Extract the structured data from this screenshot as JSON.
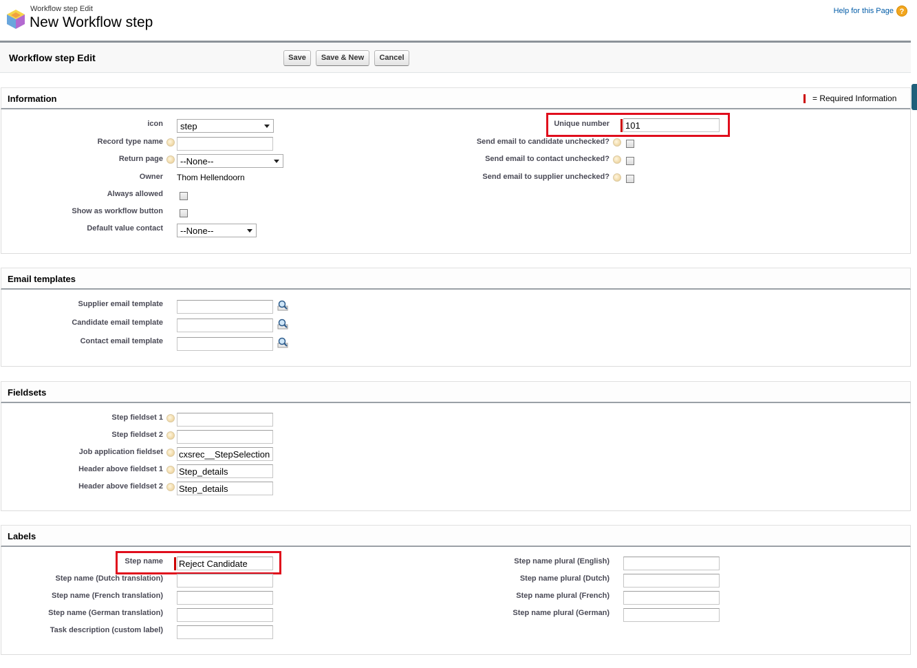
{
  "header": {
    "page_type": "Workflow step Edit",
    "page_title": "New Workflow step",
    "help_link": "Help for this Page",
    "help_icon": "help-icon"
  },
  "toolbar": {
    "title": "Workflow step Edit",
    "save": "Save",
    "save_new": "Save & New",
    "cancel": "Cancel"
  },
  "information": {
    "title": "Information",
    "required_legend": "= Required Information",
    "icon_label": "icon",
    "icon_value": "step",
    "record_type_label": "Record type name",
    "record_type_value": "",
    "return_page_label": "Return page",
    "return_page_value": "--None--",
    "owner_label": "Owner",
    "owner_value": "Thom Hellendoorn",
    "always_allowed_label": "Always allowed",
    "show_button_label": "Show as workflow button",
    "default_contact_label": "Default value contact",
    "default_contact_value": "--None--",
    "unique_number_label": "Unique number",
    "unique_number_value": "101",
    "send_candidate_label": "Send email to candidate unchecked?",
    "send_contact_label": "Send email to contact unchecked?",
    "send_supplier_label": "Send email to supplier unchecked?"
  },
  "email_templates": {
    "title": "Email templates",
    "supplier_label": "Supplier email template",
    "candidate_label": "Candidate email template",
    "contact_label": "Contact email template"
  },
  "fieldsets": {
    "title": "Fieldsets",
    "step_fieldset_1_label": "Step fieldset 1",
    "step_fieldset_1_value": "",
    "step_fieldset_2_label": "Step fieldset 2",
    "step_fieldset_2_value": "",
    "job_app_label": "Job application fieldset",
    "job_app_value": "cxsrec__StepSelection",
    "header_1_label": "Header above fieldset 1",
    "header_1_value": "Step_details",
    "header_2_label": "Header above fieldset 2",
    "header_2_value": "Step_details"
  },
  "labels": {
    "title": "Labels",
    "step_name_label": "Step name",
    "step_name_value": "Reject Candidate",
    "dutch_label": "Step name (Dutch translation)",
    "french_label": "Step name (French translation)",
    "german_label": "Step name (German translation)",
    "task_desc_label": "Task description (custom label)",
    "plural_en_label": "Step name plural (English)",
    "plural_nl_label": "Step name plural (Dutch)",
    "plural_fr_label": "Step name plural (French)",
    "plural_de_label": "Step name plural (German)"
  },
  "colors": {
    "required": "#cc0000",
    "highlight": "#e00d1c",
    "link": "#015ba7"
  }
}
